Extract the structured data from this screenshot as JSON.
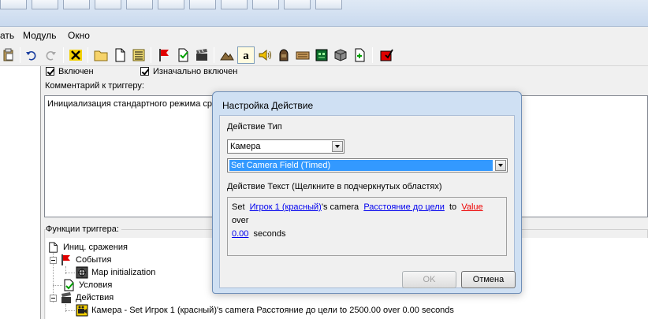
{
  "menu": {
    "items": [
      "ать",
      "Модуль",
      "Окно"
    ]
  },
  "trigger": {
    "enabled_label": "Включен",
    "initially_enabled_label": "Изначально включен",
    "comment_label": "Комментарий к триггеру:",
    "comment_text": "Инициализация стандартного режима ср",
    "functions_label": "Функции триггера:",
    "tree": {
      "root": "Иниц. сражения",
      "events": "События",
      "event_item": "Map initialization",
      "conditions": "Условия",
      "actions": "Действия",
      "action_item": "Камера - Set Игрок 1 (красный)'s camera Расстояние до цели to 2500.00 over 0.00 seconds"
    }
  },
  "dialog": {
    "title": "Настройка Действие",
    "type_label": "Действие Тип",
    "type_value": "Камера",
    "function_value": "Set Camera Field (Timed)",
    "text_label": "Действие Текст (Щелкните в подчеркнутых областях)",
    "text": {
      "w1": "Set",
      "player": "Игрок 1 (красный)",
      "w2": "'s camera",
      "field": "Расстояние до цели",
      "w3": "to",
      "value": "Value",
      "w4": "over",
      "duration": "0.00",
      "w5": "seconds"
    },
    "ok_label": "OK",
    "cancel_label": "Отмена"
  },
  "colors": {
    "link": "#0000ee",
    "invalid_link": "#ee0000",
    "selection": "#3399ff"
  }
}
